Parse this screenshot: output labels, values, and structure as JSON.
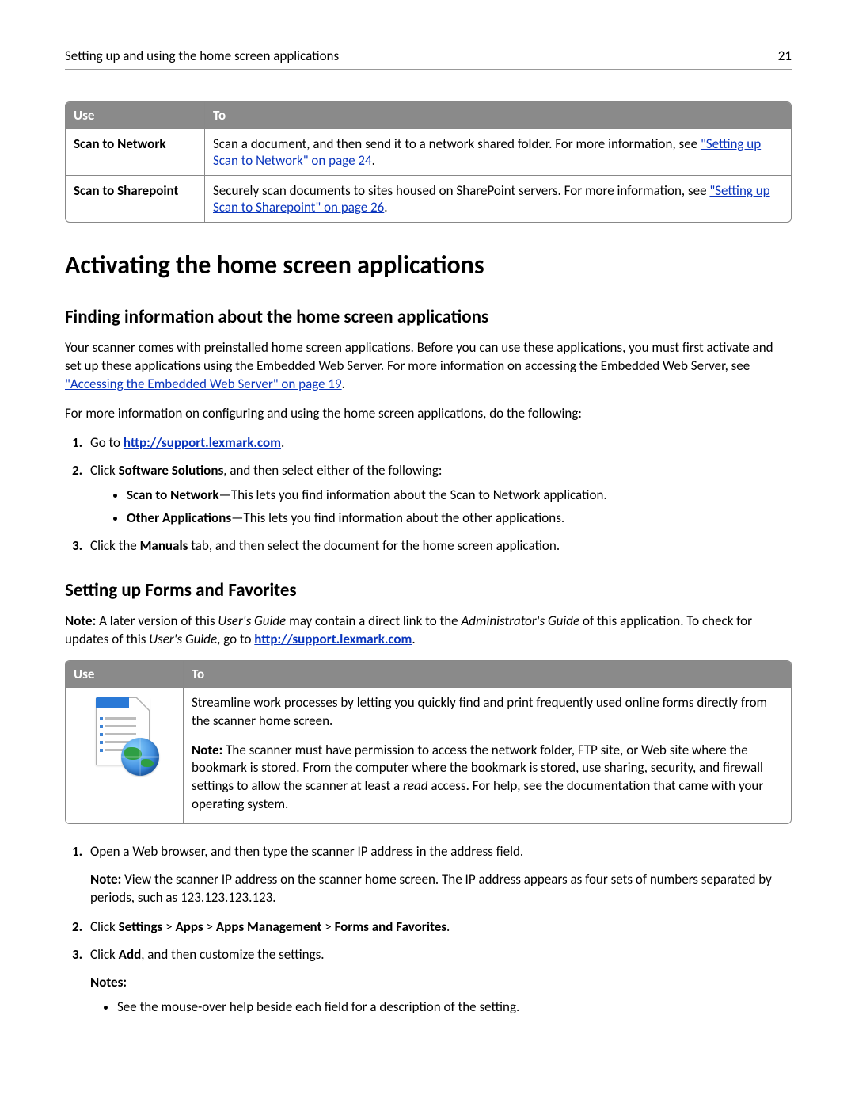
{
  "header": {
    "title": "Setting up and using the home screen applications",
    "page": "21"
  },
  "table1": {
    "cols": {
      "use": "Use",
      "to": "To"
    },
    "rows": [
      {
        "use": "Scan to Network",
        "to_pre": "Scan a document, and then send it to a network shared folder. For more information, see ",
        "link": "\"Setting up Scan to Network\" on page 24",
        "to_post": "."
      },
      {
        "use": "Scan to Sharepoint",
        "to_pre": "Securely scan documents to sites housed on SharePoint servers. For more information, see ",
        "link": "\"Setting up Scan to Sharepoint\" on page 26",
        "to_post": "."
      }
    ]
  },
  "h1": "Activating the home screen applications",
  "h2a": "Finding information about the home screen applications",
  "pA_pre": "Your scanner comes with preinstalled home screen applications. Before you can use these applications, you must first activate and set up these applications using the Embedded Web Server. For more information on accessing the Embedded Web Server, see ",
  "pA_link": "\"Accessing the Embedded Web Server\" on page 19",
  "pA_post": ".",
  "pB": "For more information on configuring and using the home screen applications, do the following:",
  "steps1": {
    "s1_pre": "Go to ",
    "s1_url": "http://support.lexmark.com",
    "s1_post": ".",
    "s2_pre": "Click ",
    "s2_b": "Software Solutions",
    "s2_post": ", and then select either of the following:",
    "b1_b": "Scan to Network",
    "b1_rest": "—This lets you find information about the Scan to Network application.",
    "b2_b": "Other Applications",
    "b2_rest": "—This lets you find information about the other applications.",
    "s3_pre": "Click the ",
    "s3_b": "Manuals",
    "s3_post": " tab, and then select the document for the home screen application."
  },
  "h2b": "Setting up Forms and Favorites",
  "note1_label": "Note: ",
  "note1_a": "A later version of this ",
  "note1_i1": "User's Guide",
  "note1_b": " may contain a direct link to the ",
  "note1_i2": "Administrator's Guide",
  "note1_c": " of this application. To check for updates of this ",
  "note1_i3": "User's Guide",
  "note1_d": ", go to ",
  "note1_url": "http://support.lexmark.com",
  "note1_e": ".",
  "table2": {
    "cols": {
      "use": "Use",
      "to": "To"
    },
    "top": "Streamline work processes by letting you quickly find and print frequently used online forms directly from the scanner home screen.",
    "note_label": "Note: ",
    "note_a": "The scanner must have permission to access the network folder, FTP site, or Web site where the bookmark is stored. From the computer where the bookmark is stored, use sharing, security, and firewall settings to allow the scanner at least a ",
    "note_i": "read",
    "note_b": " access. For help, see the documentation that came with your operating system."
  },
  "steps2": {
    "s1": "Open a Web browser, and then type the scanner IP address in the address field.",
    "s1n_label": "Note: ",
    "s1n": "View the scanner IP address on the scanner home screen. The IP address appears as four sets of numbers separated by periods, such as 123.123.123.123.",
    "s2_pre": "Click ",
    "s2_b1": "Settings",
    "s2_gt": " > ",
    "s2_b2": "Apps",
    "s2_b3": "Apps Management",
    "s2_b4": "Forms and Favorites",
    "s2_post": ".",
    "s3_pre": "Click ",
    "s3_b": "Add",
    "s3_post": ", and then customize the settings.",
    "notes": "Notes:",
    "nb1": "See the mouse-over help beside each field for a description of the setting."
  }
}
